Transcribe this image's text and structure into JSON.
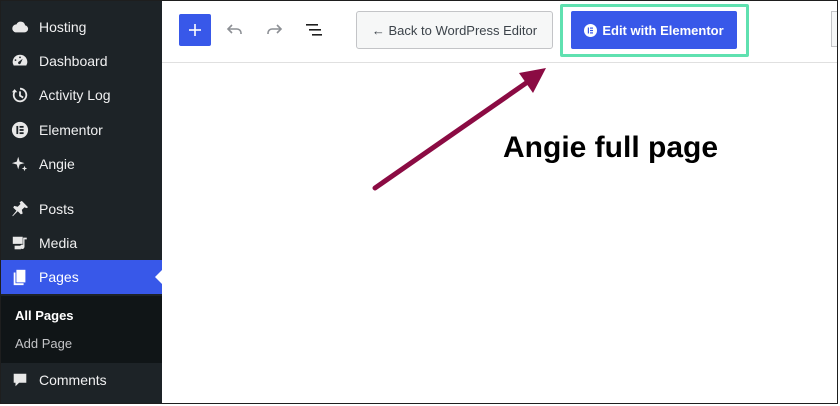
{
  "sidebar": {
    "items": [
      {
        "label": "Hosting",
        "icon": "cloud-icon"
      },
      {
        "label": "Dashboard",
        "icon": "dashboard-gauge-icon"
      },
      {
        "label": "Activity Log",
        "icon": "history-icon"
      },
      {
        "label": "Elementor",
        "icon": "elementor-logo-icon"
      },
      {
        "label": "Angie",
        "icon": "sparkle-icon"
      },
      {
        "label": "Posts",
        "icon": "pushpin-icon"
      },
      {
        "label": "Media",
        "icon": "media-icon"
      },
      {
        "label": "Pages",
        "icon": "pages-icon"
      },
      {
        "label": "Comments",
        "icon": "comment-bubble-icon"
      }
    ],
    "submenu": [
      {
        "label": "All Pages"
      },
      {
        "label": "Add Page"
      }
    ]
  },
  "toolbar": {
    "back_label": "← Back to WordPress Editor",
    "elementor_label": "Edit with Elementor"
  },
  "canvas": {
    "annotation": "Angie full page"
  },
  "colors": {
    "accent": "#3858e9",
    "sidebar_bg": "#1d2327",
    "highlight": "#5fe1b0",
    "arrow": "#8b0b43"
  }
}
